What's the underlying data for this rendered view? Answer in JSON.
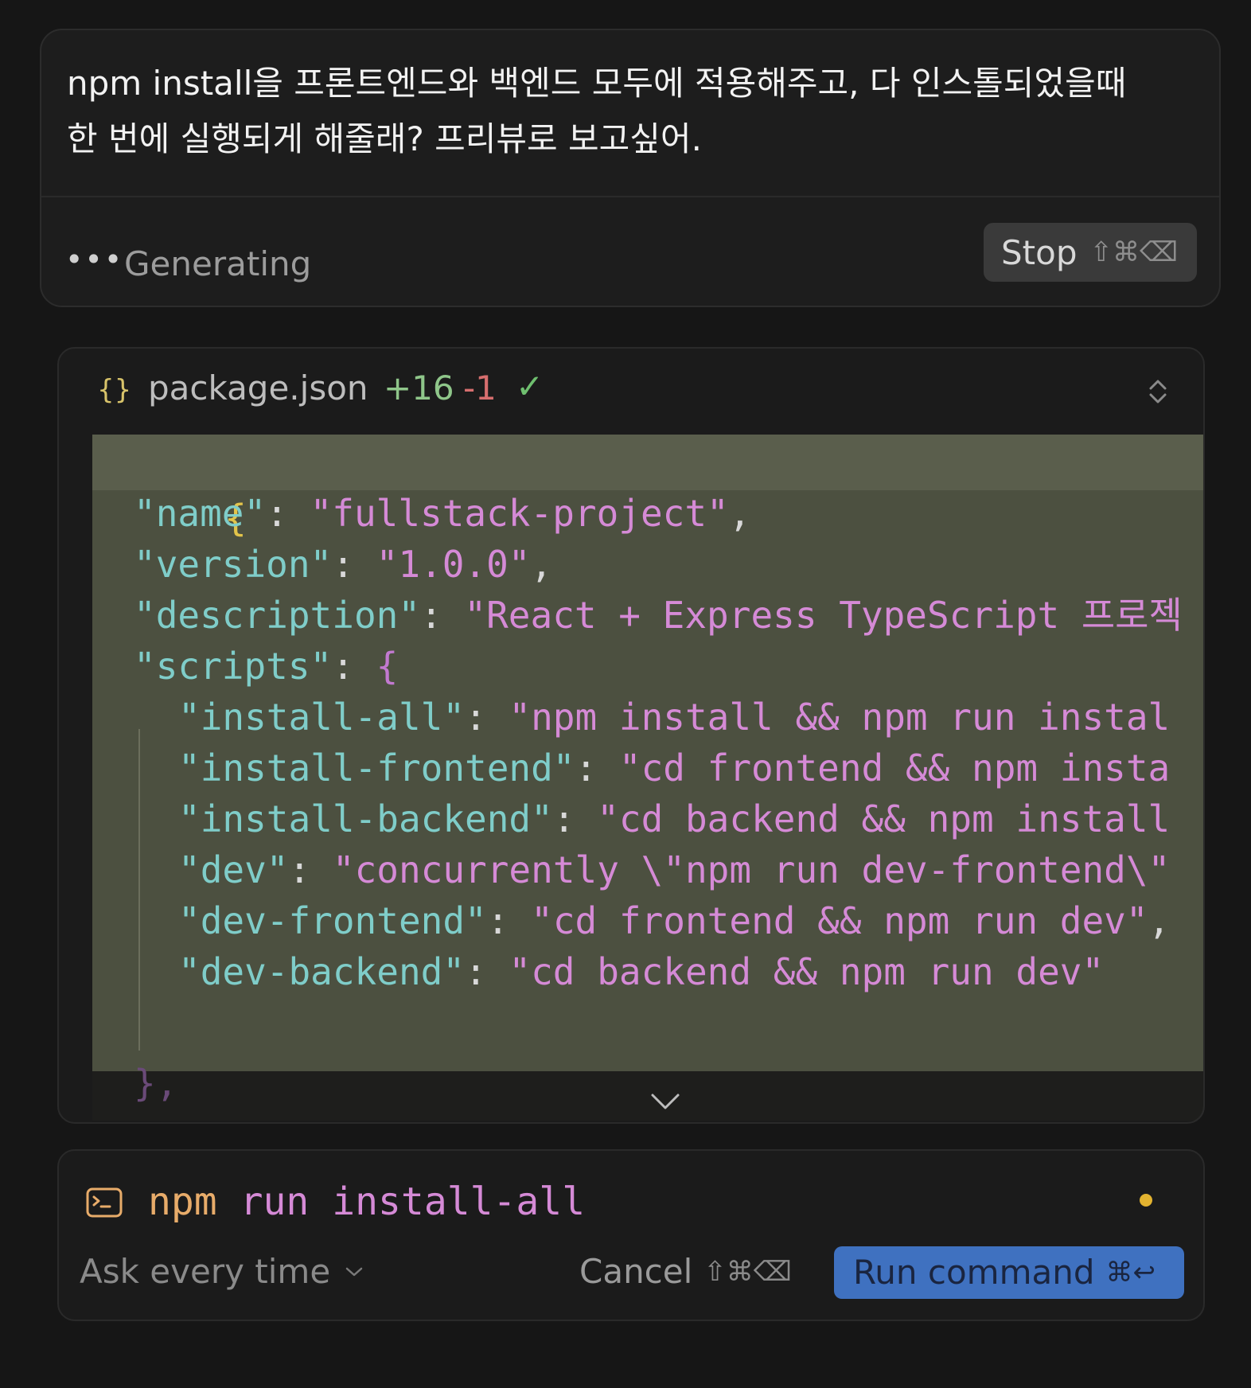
{
  "prompt": {
    "text": "npm install을 프론트엔드와 백엔드 모두에 적용해주고, 다 인스톨되었을때\n한 번에 실행되게 해줄래? 프리뷰로 보고싶어.",
    "status_dots": "•••",
    "status_label": "Generating",
    "stop_label": "Stop",
    "stop_shortcut": "⇧⌘⌫"
  },
  "file": {
    "icon": "braces-icon",
    "icon_glyph": "{}",
    "name": "package.json",
    "added": "+16",
    "removed": "-1",
    "check_glyph": "✓",
    "lines": [
      {
        "open": "{"
      },
      {
        "key": "\"name\"",
        "colon": ": ",
        "value": "\"fullstack-project\"",
        "end": ","
      },
      {
        "key": "\"version\"",
        "colon": ": ",
        "value": "\"1.0.0\"",
        "end": ","
      },
      {
        "key": "\"description\"",
        "colon": ": ",
        "value": "\"React + Express TypeScript 프로젝"
      },
      {
        "key": "\"scripts\"",
        "colon": ": ",
        "brace": "{"
      },
      {
        "key": "\"install-all\"",
        "colon": ": ",
        "value": "\"npm install && npm run instal"
      },
      {
        "key": "\"install-frontend\"",
        "colon": ": ",
        "value": "\"cd frontend && npm insta"
      },
      {
        "key": "\"install-backend\"",
        "colon": ": ",
        "value": "\"cd backend && npm install"
      },
      {
        "key": "\"dev\"",
        "colon": ": ",
        "value": "\"concurrently \\\"npm run dev-frontend\\\""
      },
      {
        "key": "\"dev-frontend\"",
        "colon": ": ",
        "value": "\"cd frontend && npm run dev\"",
        "end": ","
      },
      {
        "key": "\"dev-backend\"",
        "colon": ": ",
        "value": "\"cd backend && npm run dev\""
      },
      {
        "close": "},"
      }
    ]
  },
  "terminal": {
    "cmd_npm": "npm",
    "cmd_run": "run",
    "cmd_arg": "install-all",
    "ask_label": "Ask every time",
    "cancel_label": "Cancel",
    "cancel_shortcut": "⇧⌘⌫",
    "run_label": "Run command",
    "run_shortcut": "⌘↩"
  },
  "colors": {
    "background": "#161616",
    "accent": "#3f71c0",
    "added": "#8fc68a",
    "removed": "#d66e6e",
    "status_dot": "#e3b330"
  }
}
